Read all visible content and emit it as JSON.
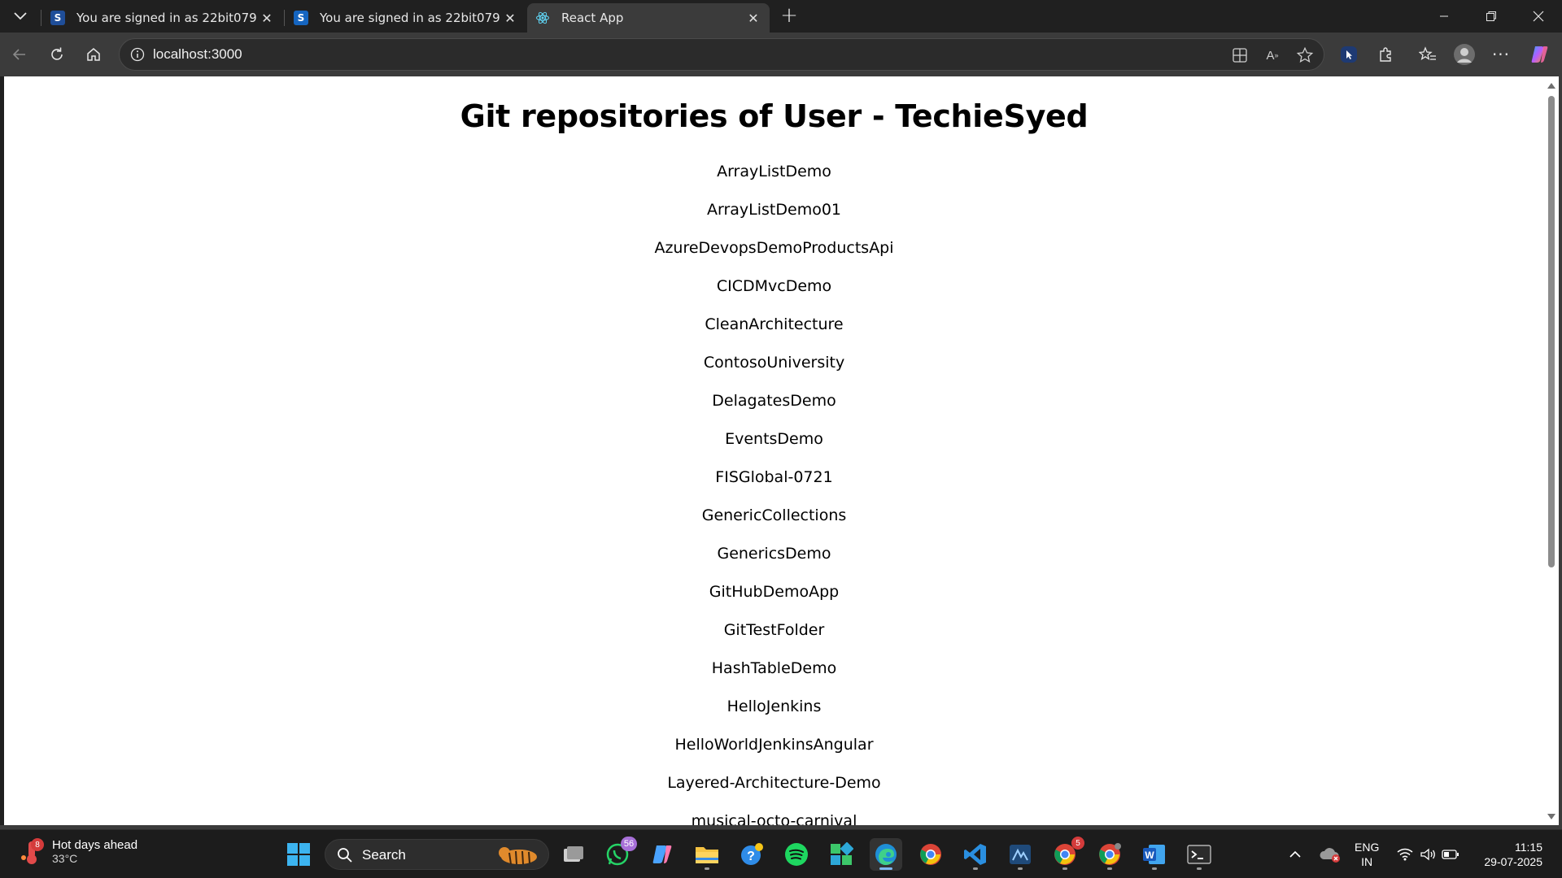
{
  "browser": {
    "tabs": [
      {
        "title": "You are signed in as 22bit079",
        "favicon": "s-app-icon",
        "active": false
      },
      {
        "title": "You are signed in as 22bit079",
        "favicon": "s-app-icon",
        "active": false
      },
      {
        "title": "React App",
        "favicon": "react-icon",
        "active": true
      }
    ],
    "address_url": "localhost:3000"
  },
  "page": {
    "heading": "Git repositories of User - TechieSyed",
    "repositories": [
      "ArrayListDemo",
      "ArrayListDemo01",
      "AzureDevopsDemoProductsApi",
      "CICDMvcDemo",
      "CleanArchitecture",
      "ContosoUniversity",
      "DelagatesDemo",
      "EventsDemo",
      "FISGlobal-0721",
      "GenericCollections",
      "GenericsDemo",
      "GitHubDemoApp",
      "GitTestFolder",
      "HashTableDemo",
      "HelloJenkins",
      "HelloWorldJenkinsAngular",
      "Layered-Architecture-Demo",
      "musical-octo-carnival"
    ]
  },
  "taskbar": {
    "weather": {
      "title": "Hot days ahead",
      "temp": "33°C",
      "alert_count": "8"
    },
    "search_label": "Search",
    "whatsapp_badge": "56",
    "chrome_badge": "5",
    "lang_line1": "ENG",
    "lang_line2": "IN",
    "time": "11:15",
    "date": "29-07-2025"
  },
  "colors": {
    "accent": "#7fb7f2",
    "tab_active_bg": "#3b3b3b",
    "chrome_bg": "#202020"
  }
}
